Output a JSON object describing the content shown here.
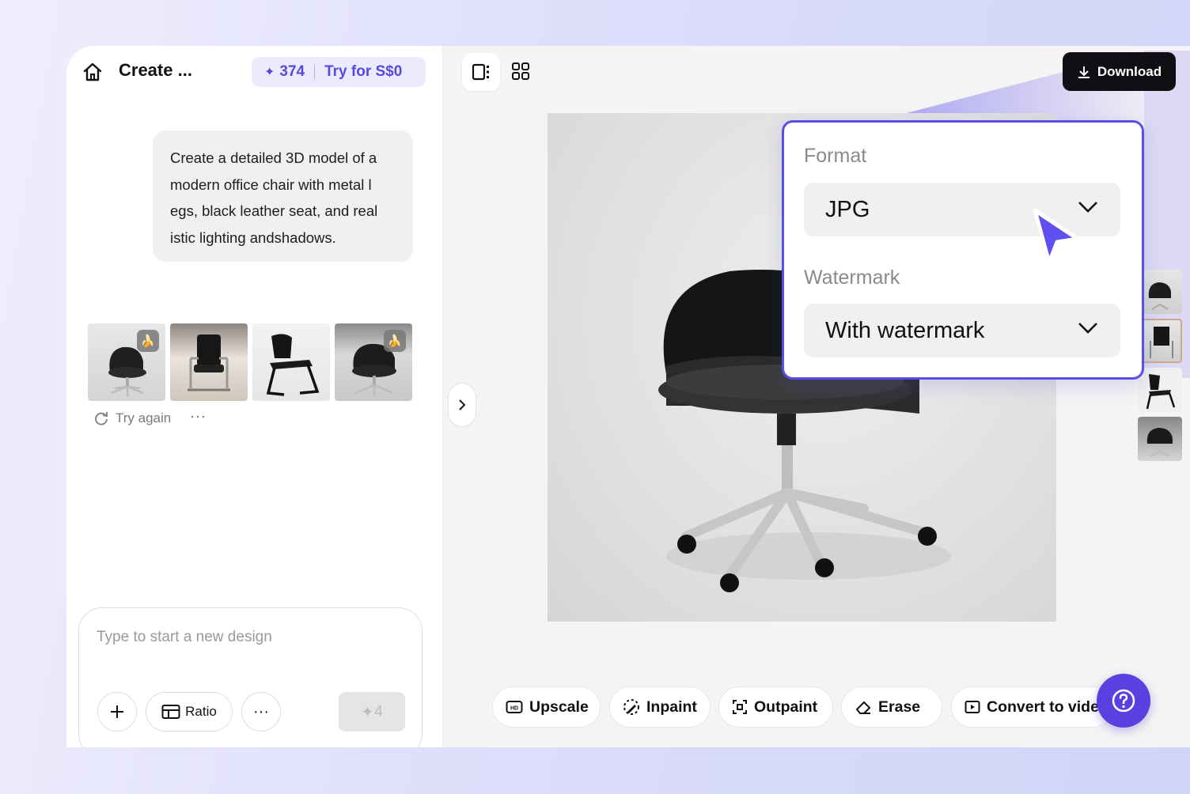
{
  "header": {
    "title": "Create ...",
    "credits_count": "374",
    "trial_label": "Try for S$0",
    "download_label": "Download"
  },
  "chat": {
    "prompt": "Create a detailed 3D model of a modern office chair with metal legs, black leather seat, and realistic lighting andshadows.",
    "prompt_lines": [
      "Create a detailed 3D model of a",
      "modern office chair with metal l",
      "egs, black leather seat, and real",
      "istic lighting andshadows."
    ],
    "retry_label": "Try again",
    "more_label": "···"
  },
  "composer": {
    "placeholder": "Type to start a new design",
    "ratio_label": "Ratio",
    "send_cost": "4"
  },
  "export_popup": {
    "format_label": "Format",
    "format_value": "JPG",
    "watermark_label": "Watermark",
    "watermark_value": "With watermark"
  },
  "toolbar": {
    "upscale": "Upscale",
    "inpaint": "Inpaint",
    "outpaint": "Outpaint",
    "erase": "Erase",
    "convert": "Convert to video"
  },
  "colors": {
    "accent": "#5b4ee6",
    "help_button": "#5b3fe0",
    "download_bg": "#0f1014",
    "credits_bg": "#ecebfd"
  },
  "icons": [
    "home-icon",
    "sparkle-icon",
    "refresh-icon",
    "plus-icon",
    "ratio-icon",
    "more-icon",
    "chevron-right-icon",
    "single-view-icon",
    "grid-view-icon",
    "download-icon",
    "chevron-down-icon",
    "cursor-icon",
    "hd-icon",
    "inpaint-icon",
    "outpaint-icon",
    "eraser-icon",
    "video-icon",
    "help-icon"
  ]
}
